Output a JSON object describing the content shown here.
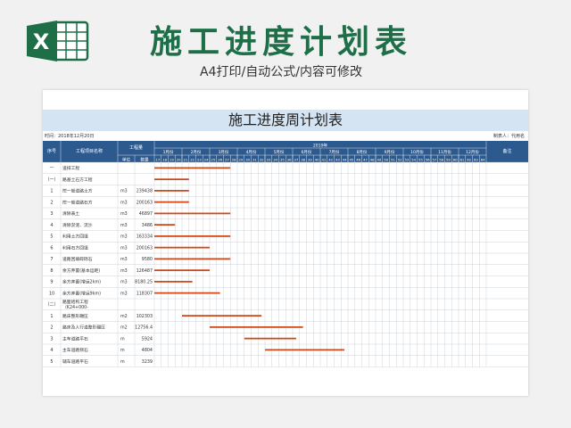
{
  "header": {
    "title": "施工进度计划表",
    "subtitle": "A4打印/自动公式/内容可修改",
    "logo_letter": "X"
  },
  "sheet": {
    "title": "施工进度周计划表",
    "time_label": "时间：2018年12月20日",
    "maker_label": "制表人：代用名",
    "columns": {
      "seq": "序号",
      "name": "工程项目名称",
      "quantity": "工程量",
      "unit": "单位",
      "amount": "数量",
      "year": "2019年",
      "remark": "备注"
    },
    "months": [
      "1月份",
      "2月份",
      "3月份",
      "4月份",
      "5月份",
      "6月份",
      "7月份",
      "8月份",
      "9月份",
      "10月份",
      "11月份",
      "12月份"
    ],
    "weeks": [
      17,
      18,
      19,
      20,
      21,
      22,
      23,
      24,
      25,
      26,
      27,
      28,
      29,
      30,
      31,
      32,
      33,
      34,
      35,
      36,
      37,
      38,
      39,
      40,
      41,
      42,
      43,
      44,
      45,
      46,
      47,
      48,
      49,
      50,
      51,
      52,
      53,
      54,
      55,
      56,
      57,
      58,
      59,
      60,
      61,
      62,
      63,
      64
    ],
    "rows": [
      {
        "seq": "一",
        "name": "道排工程",
        "unit": "",
        "amount": "",
        "bar": [
          0,
          11
        ]
      },
      {
        "seq": "（一）",
        "name": "路基土石方工程",
        "unit": "",
        "amount": "",
        "bar": [
          0,
          5
        ]
      },
      {
        "seq": "1",
        "name": "挖一般道路土方",
        "unit": "m3",
        "amount": "239438",
        "bar": [
          0,
          5
        ]
      },
      {
        "seq": "2",
        "name": "挖一般道路石方",
        "unit": "m3",
        "amount": "200163",
        "bar": [
          0,
          5
        ]
      },
      {
        "seq": "3",
        "name": "清除表土",
        "unit": "m3",
        "amount": "46897",
        "bar": [
          0,
          11
        ]
      },
      {
        "seq": "4",
        "name": "清除淤泥、流沙",
        "unit": "m3",
        "amount": "3486",
        "bar": [
          0,
          3
        ]
      },
      {
        "seq": "5",
        "name": "利用土方回填",
        "unit": "m3",
        "amount": "163334",
        "bar": [
          0,
          11
        ]
      },
      {
        "seq": "6",
        "name": "利用石方回填",
        "unit": "m3",
        "amount": "200163",
        "bar": [
          0,
          8
        ]
      },
      {
        "seq": "7",
        "name": "道路回填碎砾石",
        "unit": "m3",
        "amount": "9580",
        "bar": [
          0,
          11
        ]
      },
      {
        "seq": "8",
        "name": "余方弃置(基本运距)",
        "unit": "m3",
        "amount": "126487",
        "bar": [
          0,
          8
        ]
      },
      {
        "seq": "9",
        "name": "余方弃置(增运2km)",
        "unit": "m3",
        "amount": "8180.25",
        "bar": [
          0,
          5.5
        ]
      },
      {
        "seq": "10",
        "name": "余方弃置(增运9km)",
        "unit": "m3",
        "amount": "118307",
        "bar": [
          0,
          9.5
        ]
      },
      {
        "seq": "（二）",
        "name": "路面结构工程（K24+000-",
        "unit": "",
        "amount": "",
        "bar": null
      },
      {
        "seq": "1",
        "name": "路床整形碾压",
        "unit": "m2",
        "amount": "102303",
        "bar": [
          4,
          15.5
        ]
      },
      {
        "seq": "2",
        "name": "路床及人行道整形碾压",
        "unit": "m2",
        "amount": "12756.4",
        "bar": [
          8,
          21.5
        ]
      },
      {
        "seq": "3",
        "name": "主车道路平石",
        "unit": "m",
        "amount": "5924",
        "bar": [
          13,
          20.5
        ]
      },
      {
        "seq": "4",
        "name": "主车道路侧石",
        "unit": "m",
        "amount": "4804",
        "bar": [
          16,
          27.5
        ]
      },
      {
        "seq": "5",
        "name": "辅车道路平石",
        "unit": "m",
        "amount": "3239",
        "bar": null
      }
    ]
  },
  "colors": {
    "brand_green": "#1e6e48",
    "header_blue": "#2d5a8e",
    "title_band": "#d4e4f3",
    "bar_orange": "#cf4a1a"
  }
}
